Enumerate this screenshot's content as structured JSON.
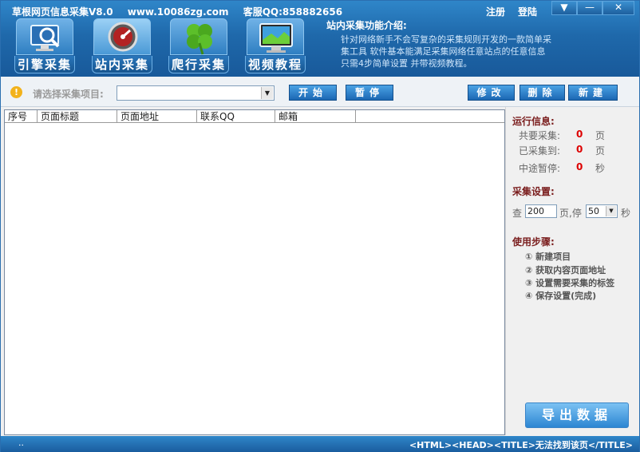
{
  "header": {
    "title": "草根网页信息采集V8.0",
    "website": "www.10086zg.com",
    "support": "客服QQ:858882656",
    "register_label": "注册",
    "login_label": "登陆",
    "window_buttons": {
      "menu": "▼",
      "minimize": "—",
      "close": "✕"
    }
  },
  "nav": [
    {
      "label": "引擎采集",
      "icon": "search-monitor-icon"
    },
    {
      "label": "站内采集",
      "icon": "gauge-icon"
    },
    {
      "label": "爬行采集",
      "icon": "clover-icon"
    },
    {
      "label": "视频教程",
      "icon": "video-monitor-icon"
    }
  ],
  "intro": {
    "title": "站内采集功能介绍:",
    "lines": [
      "针对网络新手不会写复杂的采集规则开发的一款简单采",
      "集工具 软件基本能满足采集网络任意站点的任意信息",
      "只需4步简单设置 并带视频教程。"
    ]
  },
  "toolbar": {
    "select_label": "请选择采集项目:",
    "select_value": "",
    "start_label": "开始",
    "pause_label": "暂停",
    "edit_label": "修改",
    "delete_label": "删除",
    "new_label": "新建"
  },
  "table": {
    "columns": [
      "序号",
      "页面标题",
      "页面地址",
      "联系QQ",
      "邮箱"
    ],
    "rows": []
  },
  "panel": {
    "run_info_title": "运行信息:",
    "stats": [
      {
        "label": "共要采集:",
        "value": "0",
        "unit": "页"
      },
      {
        "label": "已采集到:",
        "value": "0",
        "unit": "页"
      },
      {
        "label": "中途暂停:",
        "value": "0",
        "unit": "秒"
      }
    ],
    "settings_title": "采集设置:",
    "settings": {
      "prefix": "查",
      "pages": "200",
      "middle": "页,停",
      "seconds": "50",
      "suffix": "秒"
    },
    "steps_title": "使用步骤:",
    "steps": [
      "① 新建项目",
      "② 获取内容页面地址",
      "③ 设置需要采集的标签",
      "④ 保存设置(完成)"
    ],
    "export_label": "导出数据"
  },
  "statusbar": {
    "left": "..",
    "message": "<HTML><HEAD><TITLE>无法找到该页</TITLE>"
  }
}
